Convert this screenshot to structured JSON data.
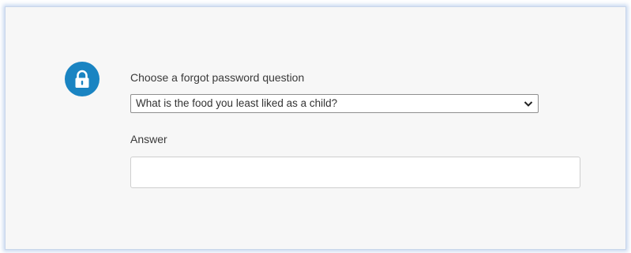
{
  "form": {
    "question_label": "Choose a forgot password question",
    "question_selected": "What is the food you least liked as a child?",
    "answer_label": "Answer",
    "answer_value": ""
  },
  "icons": {
    "badge": "lock-icon",
    "dropdown": "chevron-down-icon"
  },
  "colors": {
    "accent": "#1a84c2",
    "panel_background": "#f7f7f7"
  }
}
